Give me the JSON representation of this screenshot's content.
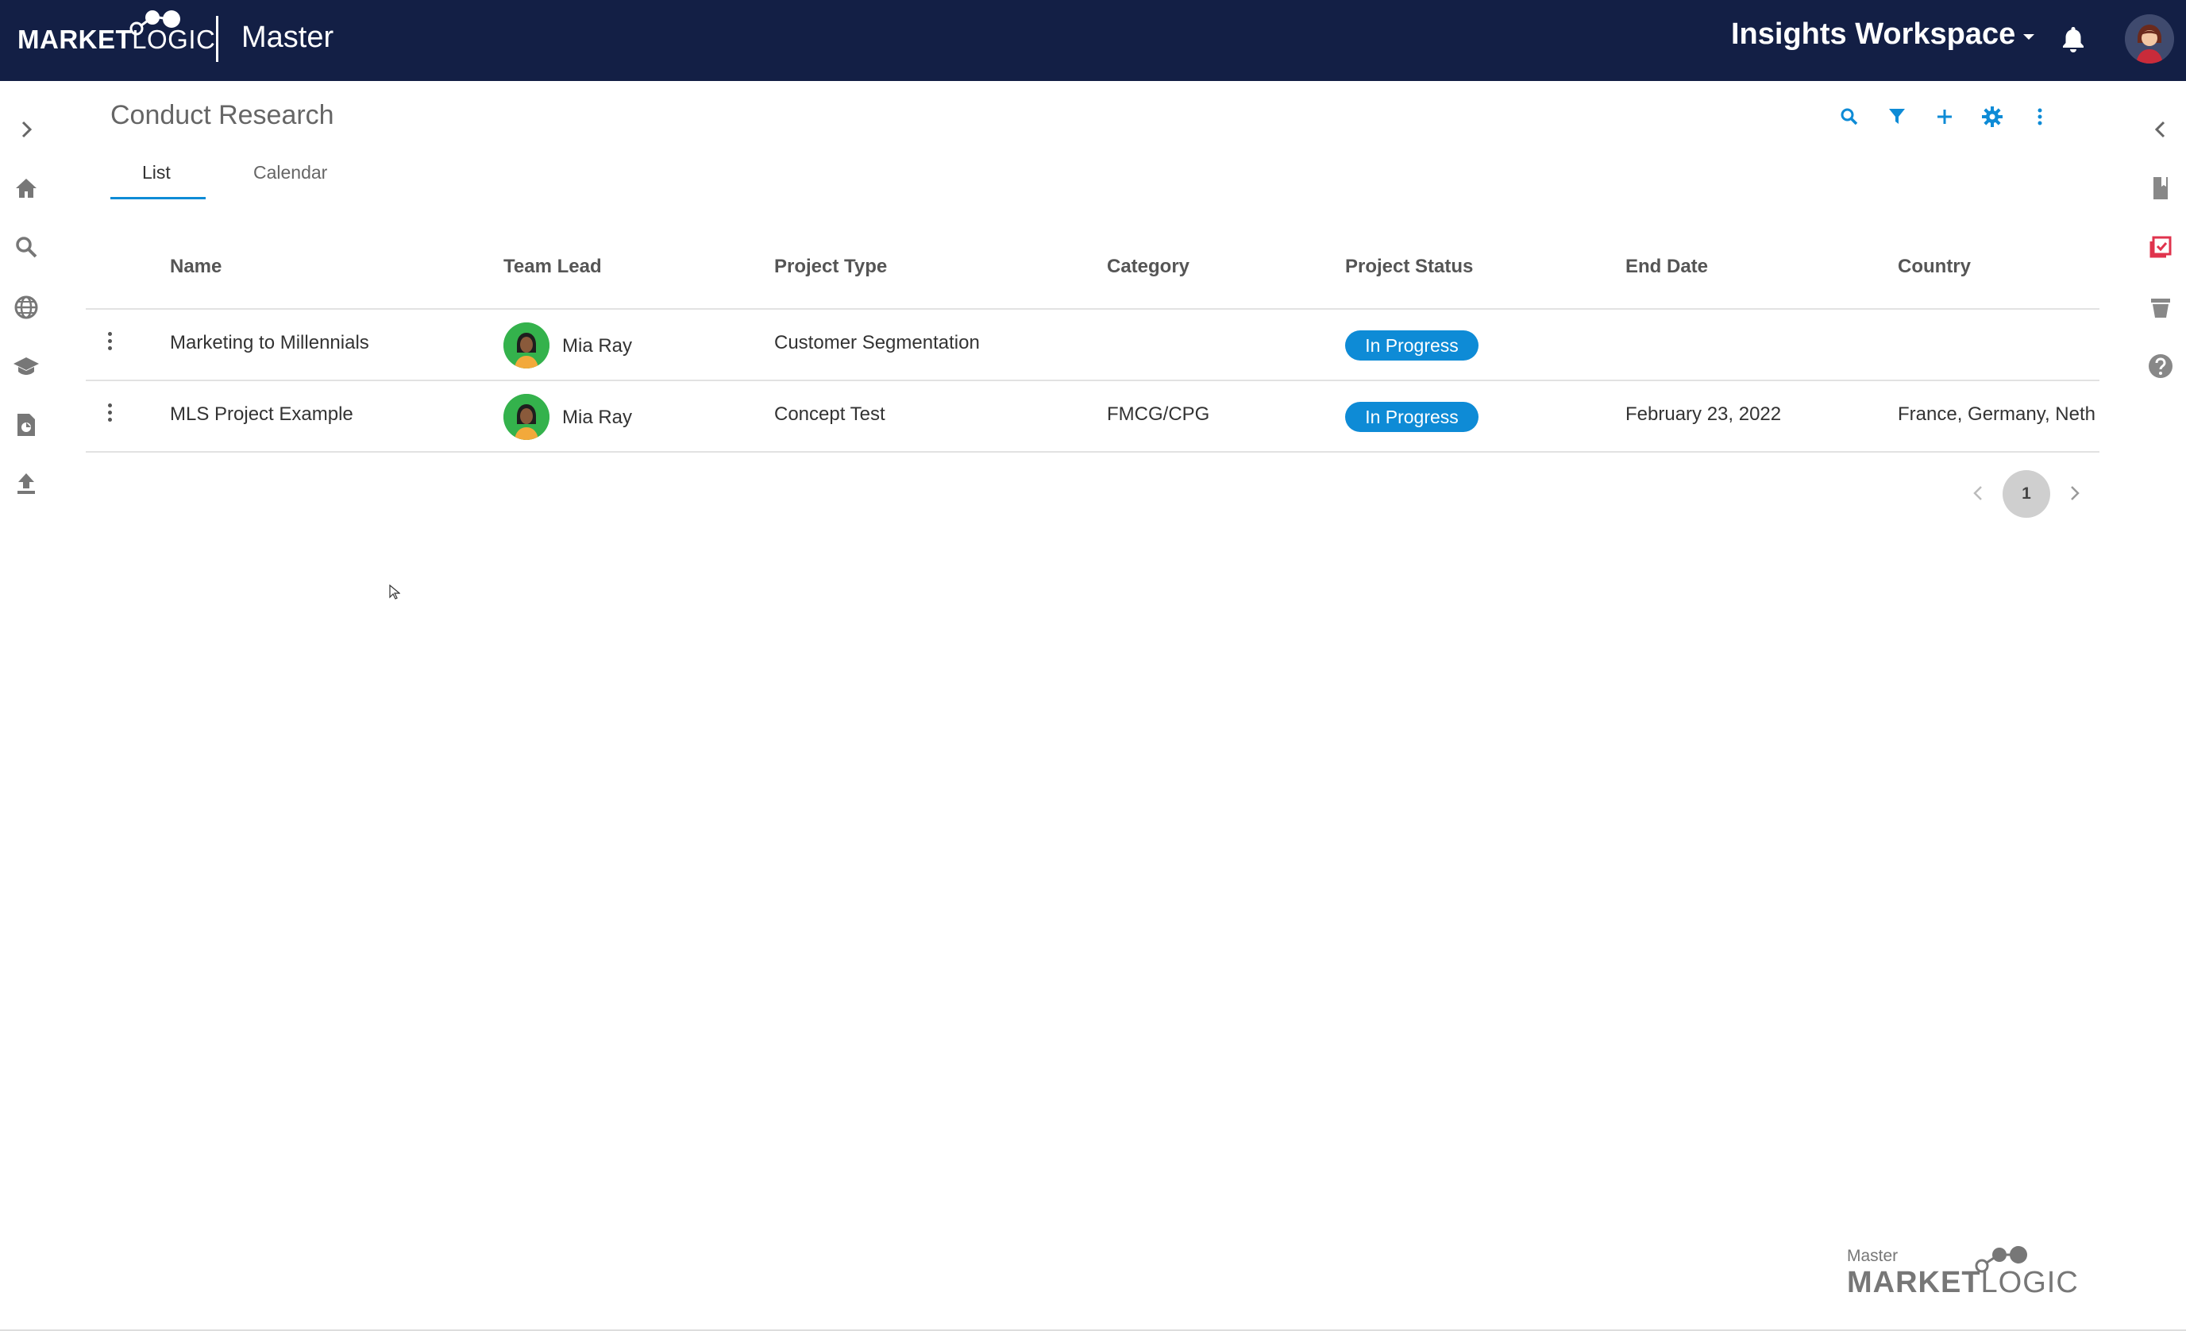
{
  "header": {
    "brand_left": "MARKET",
    "brand_right": "LOGIC",
    "app_name": "Master",
    "workspace": "Insights Workspace"
  },
  "page": {
    "title": "Conduct Research",
    "tabs": [
      "List",
      "Calendar"
    ],
    "active_tab": "List"
  },
  "table": {
    "columns": [
      "Name",
      "Team Lead",
      "Project Type",
      "Category",
      "Project Status",
      "End Date",
      "Country"
    ],
    "rows": [
      {
        "name": "Marketing to Millennials",
        "team_lead": "Mia Ray",
        "project_type": "Customer Segmentation",
        "category": "",
        "status": "In Progress",
        "end_date": "",
        "country": ""
      },
      {
        "name": "MLS Project Example",
        "team_lead": "Mia Ray",
        "project_type": "Concept Test",
        "category": "FMCG/CPG",
        "status": "In Progress",
        "end_date": "February 23, 2022",
        "country": "France, Germany, Neth"
      }
    ]
  },
  "pagination": {
    "current_page": "1"
  },
  "footer": {
    "small": "Master",
    "brand_left": "MARKET",
    "brand_right": "LOGIC"
  },
  "colors": {
    "topbar": "#131f45",
    "accent": "#0e8bd6",
    "status_badge": "#0e8bd6",
    "avatar_green": "#34b24c"
  },
  "icons": {
    "left_rail": [
      "chevron-right-icon",
      "home-icon",
      "search-icon",
      "globe-icon",
      "graduation-cap-icon",
      "document-chart-icon",
      "upload-icon"
    ],
    "right_rail": [
      "chevron-left-icon",
      "bookmark-icon",
      "checklist-icon",
      "cup-icon",
      "help-icon"
    ],
    "toolbar": [
      "search-icon",
      "filter-icon",
      "plus-icon",
      "gear-icon",
      "more-vertical-icon"
    ]
  }
}
